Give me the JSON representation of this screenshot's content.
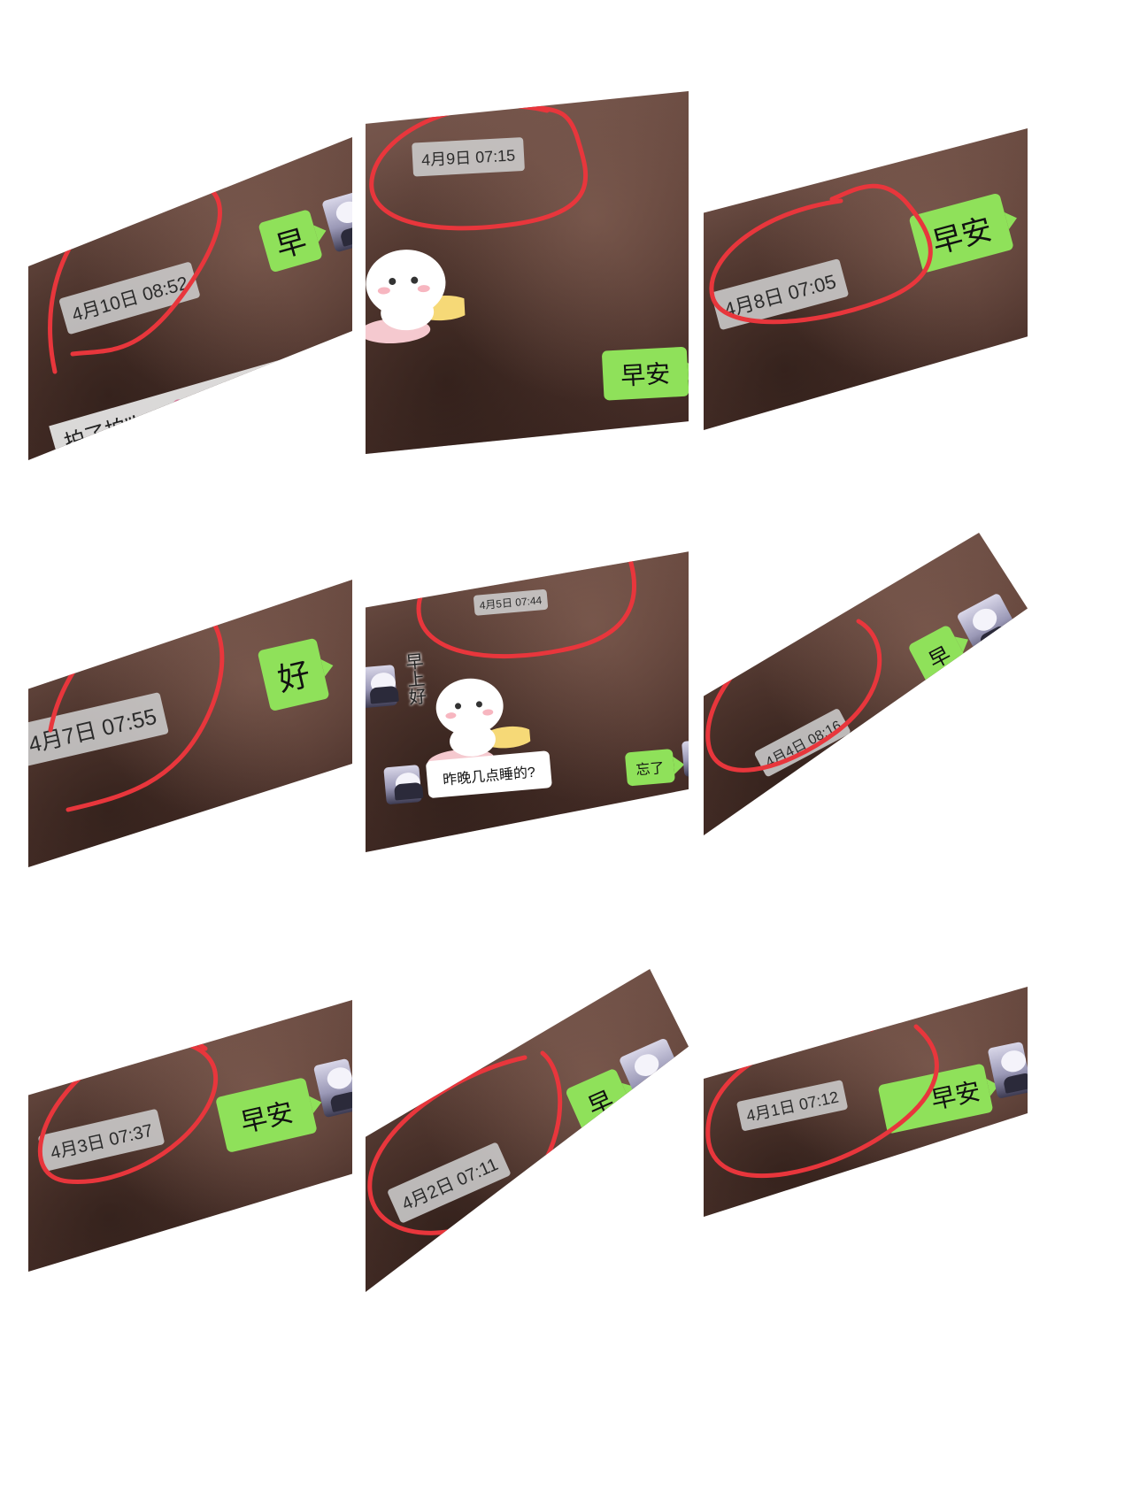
{
  "panels": [
    {
      "timestamp": "4月10日 08:52",
      "reply": "早",
      "system_message": "拍了拍\"b-as💗💕💖\"变成了啦啦啦"
    },
    {
      "timestamp": "4月9日 07:15",
      "reply": "早安"
    },
    {
      "timestamp": "4月8日 07:05",
      "reply": "早安"
    },
    {
      "timestamp": "4月7日 07:55",
      "reply": "好"
    },
    {
      "timestamp": "4月5日 07:44",
      "sticker_text": "早上好",
      "question": "昨晚几点睡的?",
      "reply": "忘了"
    },
    {
      "timestamp": "4月4日 08:16",
      "reply": "早"
    },
    {
      "timestamp": "4月3日 07:37",
      "reply": "早安"
    },
    {
      "timestamp": "4月2日 07:11",
      "reply": "早"
    },
    {
      "timestamp": "4月1日 07:12",
      "reply": "早安"
    }
  ],
  "colors": {
    "annotation": "#e8363c",
    "bubble": "#8fe15a",
    "background": "#5e4037"
  }
}
